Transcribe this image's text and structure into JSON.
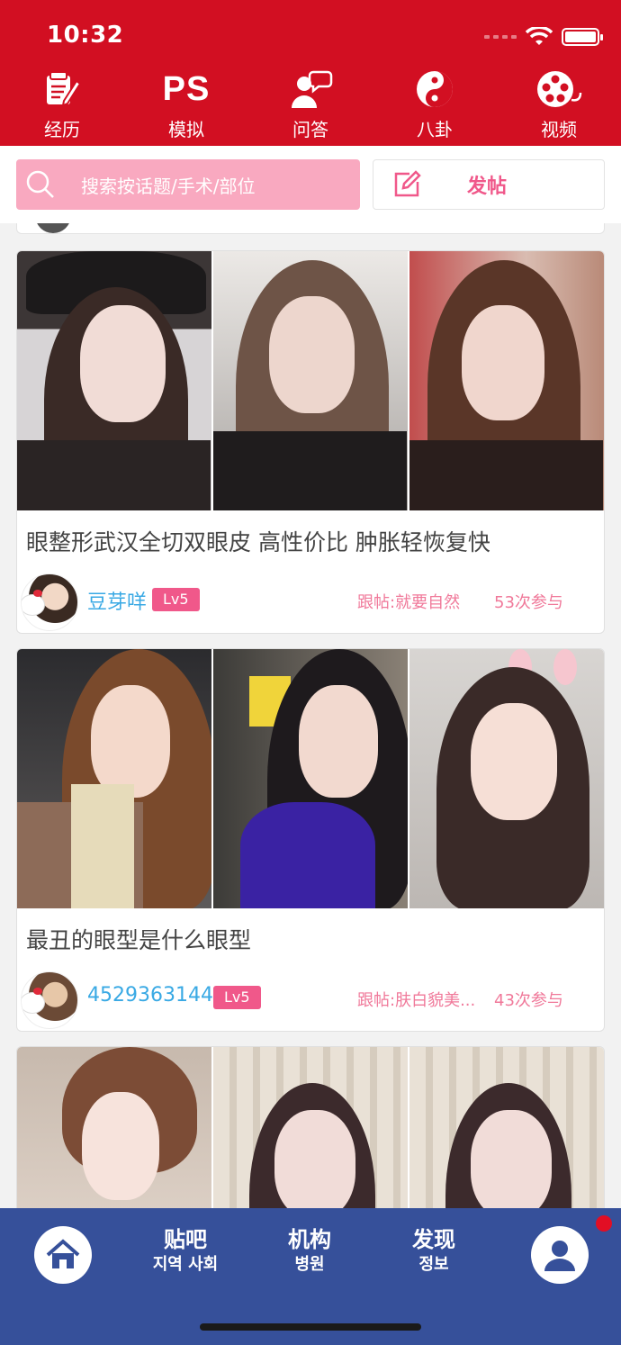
{
  "status": {
    "time": "10:32"
  },
  "topnav": {
    "items": [
      {
        "label": "经历",
        "icon": "notepad-pen-icon"
      },
      {
        "label": "模拟",
        "icon": "ps-text-icon",
        "icon_text": "PS"
      },
      {
        "label": "问答",
        "icon": "person-speech-icon"
      },
      {
        "label": "八卦",
        "icon": "yin-yang-icon"
      },
      {
        "label": "视频",
        "icon": "film-reel-icon"
      }
    ]
  },
  "search": {
    "placeholder": "搜索按话题/手术/部位"
  },
  "post_button": {
    "label": "发帖"
  },
  "posts": [
    {
      "title": "眼整形武汉全切双眼皮 高性价比 肿胀轻恢复快",
      "username": "豆芽咩",
      "level": "Lv5",
      "followup": "跟帖:就要自然",
      "count": "53次参与"
    },
    {
      "title": "最丑的眼型是什么眼型",
      "username": "4529363144",
      "level": "Lv5",
      "followup": "跟帖:肤白貌美...",
      "count": "43次参与"
    }
  ],
  "bottomnav": {
    "items": [
      {
        "main": "",
        "sub": "",
        "icon": "home-icon"
      },
      {
        "main": "贴吧",
        "sub": "지역 사회"
      },
      {
        "main": "机构",
        "sub": "병원"
      },
      {
        "main": "发现",
        "sub": "정보"
      },
      {
        "main": "",
        "sub": "",
        "icon": "user-profile-icon"
      }
    ]
  },
  "colors": {
    "header_red": "#d20f22",
    "search_pink": "#f9a9c0",
    "accent_pink": "#f0588a",
    "username_blue": "#39a9e4",
    "bottom_blue": "#36509a"
  }
}
